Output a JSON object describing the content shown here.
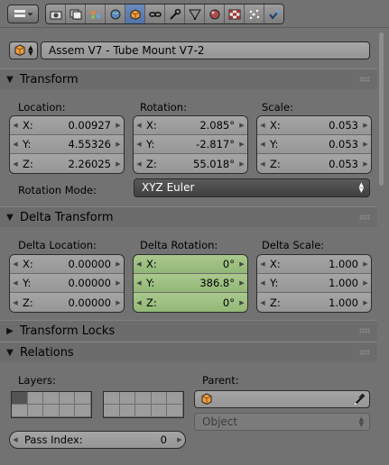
{
  "toolbar": {
    "editor_icon": "properties-editor-icon",
    "contexts": [
      {
        "icon": "render-icon",
        "active": false
      },
      {
        "icon": "render-layers-icon",
        "active": false
      },
      {
        "icon": "scene-icon",
        "active": false
      },
      {
        "icon": "world-icon",
        "active": false
      },
      {
        "icon": "object-icon",
        "active": true
      },
      {
        "icon": "constraints-icon",
        "active": false
      },
      {
        "icon": "modifiers-icon",
        "active": false
      },
      {
        "icon": "data-icon",
        "active": false
      },
      {
        "icon": "material-icon",
        "active": false
      },
      {
        "icon": "texture-icon",
        "active": false
      },
      {
        "icon": "physics-icon",
        "active": false
      }
    ]
  },
  "object": {
    "name": "Assem V7 - Tube Mount V7-2"
  },
  "transform": {
    "title": "Transform",
    "location_label": "Location:",
    "rotation_label": "Rotation:",
    "scale_label": "Scale:",
    "location": [
      {
        "axis": "X:",
        "value": "0.00927"
      },
      {
        "axis": "Y:",
        "value": "4.55326"
      },
      {
        "axis": "Z:",
        "value": "2.26025"
      }
    ],
    "rotation": [
      {
        "axis": "X:",
        "value": "2.085°"
      },
      {
        "axis": "Y:",
        "value": "-2.817°"
      },
      {
        "axis": "Z:",
        "value": "55.018°"
      }
    ],
    "scale": [
      {
        "axis": "X:",
        "value": "0.053"
      },
      {
        "axis": "Y:",
        "value": "0.053"
      },
      {
        "axis": "Z:",
        "value": "0.053"
      }
    ],
    "rotation_mode_label": "Rotation Mode:",
    "rotation_mode_value": "XYZ Euler"
  },
  "delta": {
    "title": "Delta Transform",
    "location_label": "Delta Location:",
    "rotation_label": "Delta Rotation:",
    "scale_label": "Delta Scale:",
    "location": [
      {
        "axis": "X:",
        "value": "0.00000"
      },
      {
        "axis": "Y:",
        "value": "0.00000"
      },
      {
        "axis": "Z:",
        "value": "0.00000"
      }
    ],
    "rotation": [
      {
        "axis": "X:",
        "value": "0°"
      },
      {
        "axis": "Y:",
        "value": "386.8°"
      },
      {
        "axis": "Z:",
        "value": "0°"
      }
    ],
    "scale": [
      {
        "axis": "X:",
        "value": "1.000"
      },
      {
        "axis": "Y:",
        "value": "1.000"
      },
      {
        "axis": "Z:",
        "value": "1.000"
      }
    ],
    "rotation_color": "#a3c487"
  },
  "locks": {
    "title": "Transform Locks"
  },
  "relations": {
    "title": "Relations",
    "layers_label": "Layers:",
    "parent_label": "Parent:",
    "parent_type": "Object",
    "pass_index_label": "Pass Index:",
    "pass_index_value": "0"
  }
}
